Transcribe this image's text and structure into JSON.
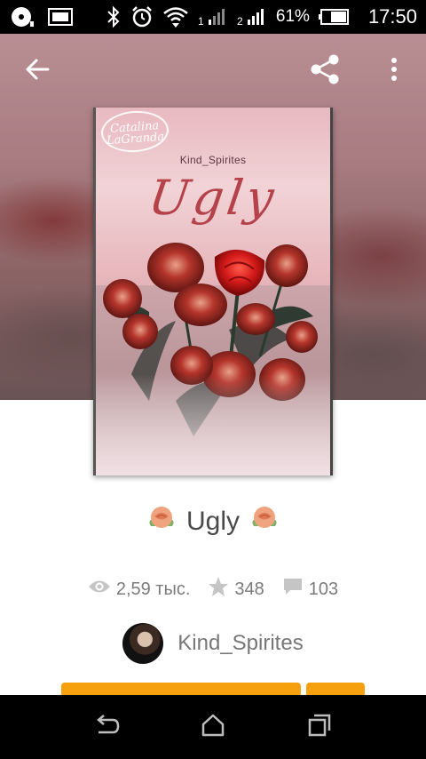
{
  "status_bar": {
    "battery_percent": "61%",
    "time": "17:50",
    "sim1_label": "1",
    "sim2_label": "2",
    "icons": [
      "media-icon",
      "image-icon",
      "bluetooth-icon",
      "alarm-icon",
      "wifi-icon",
      "signal-icon",
      "battery-icon"
    ]
  },
  "toolbar": {
    "back_icon": "arrow-left-icon",
    "share_icon": "share-icon",
    "menu_icon": "more-vertical-icon"
  },
  "cover": {
    "badge_line1": "Catalina",
    "badge_line2": "LaGranda",
    "author": "Kind_Spirites",
    "title": "Ugly"
  },
  "book": {
    "title": "Ugly",
    "title_emoji": "rose-icon"
  },
  "stats": {
    "reads": "2,59 тыс.",
    "votes": "348",
    "comments": "103"
  },
  "author": {
    "name": "Kind_Spirites"
  },
  "colors": {
    "accent": "#f5a00c",
    "text_dark": "#4a4a4a",
    "text_muted": "#7b7b7b"
  },
  "navbar": {
    "icons": [
      "back-nav-icon",
      "home-nav-icon",
      "recents-nav-icon"
    ]
  }
}
